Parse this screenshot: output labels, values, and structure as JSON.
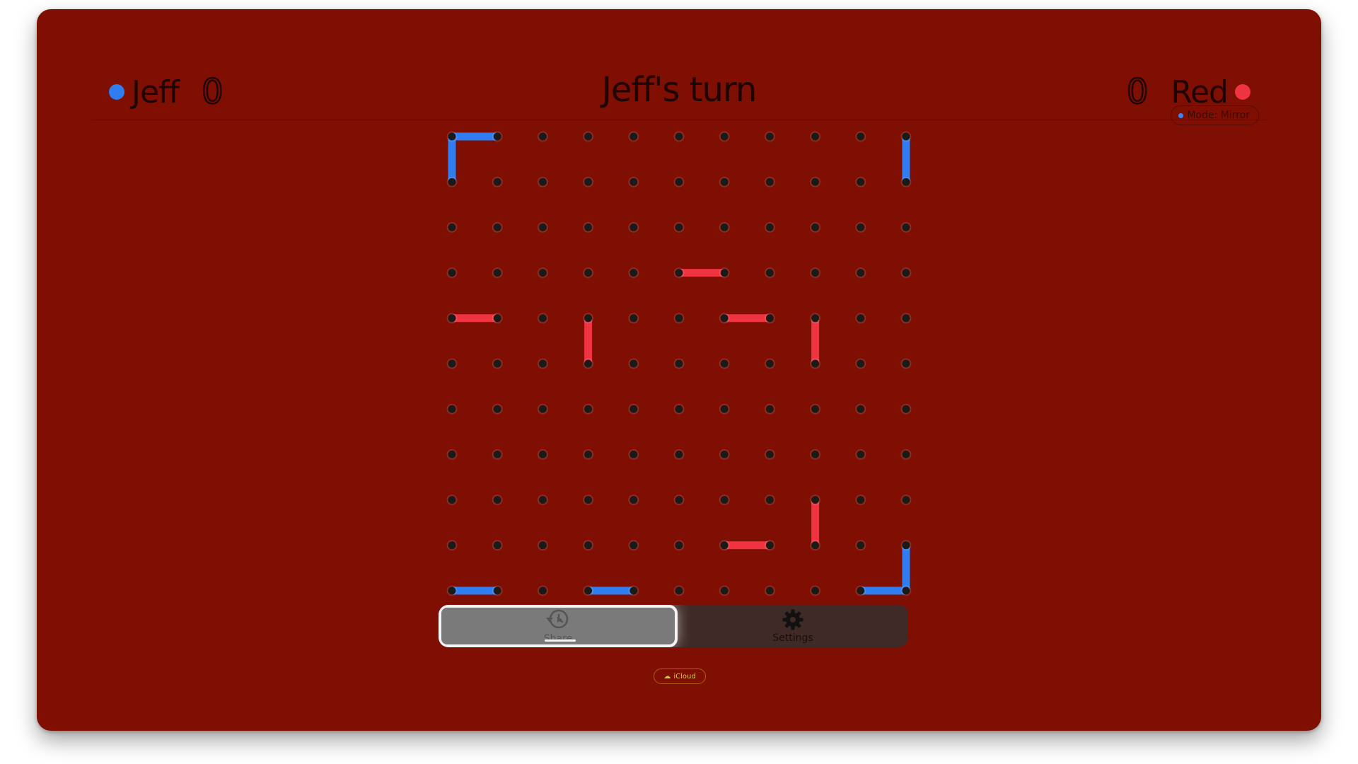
{
  "header": {
    "title": "Jeff's turn",
    "left_player": {
      "name": "Jeff",
      "score": "0",
      "color": "#2f7df0"
    },
    "right_player": {
      "name": "Red",
      "score": "0",
      "color": "#ef3340"
    },
    "mode_label": "Mode: Mirror"
  },
  "board": {
    "rows": 11,
    "cols": 11,
    "dot_color": "#1a1a1a",
    "blue_lines": [
      [
        [
          0,
          0
        ],
        [
          1,
          0
        ]
      ],
      [
        [
          0,
          0
        ],
        [
          0,
          1
        ]
      ],
      [
        [
          10,
          0
        ],
        [
          10,
          1
        ]
      ],
      [
        [
          0,
          10
        ],
        [
          1,
          10
        ]
      ],
      [
        [
          3,
          10
        ],
        [
          4,
          10
        ]
      ],
      [
        [
          9,
          10
        ],
        [
          10,
          10
        ]
      ],
      [
        [
          10,
          9
        ],
        [
          10,
          10
        ]
      ]
    ],
    "red_lines": [
      [
        [
          5,
          3
        ],
        [
          6,
          3
        ]
      ],
      [
        [
          0,
          4
        ],
        [
          1,
          4
        ]
      ],
      [
        [
          3,
          4
        ],
        [
          3,
          5
        ]
      ],
      [
        [
          6,
          4
        ],
        [
          7,
          4
        ]
      ],
      [
        [
          8,
          4
        ],
        [
          8,
          5
        ]
      ],
      [
        [
          8,
          8
        ],
        [
          8,
          9
        ]
      ],
      [
        [
          6,
          9
        ],
        [
          7,
          9
        ]
      ]
    ]
  },
  "toolbar": {
    "share_label": "Share",
    "settings_label": "Settings",
    "share_icon": "history-icon",
    "settings_icon": "gear-icon"
  },
  "badge": {
    "label": "iCloud",
    "icon": "cloud-icon"
  }
}
